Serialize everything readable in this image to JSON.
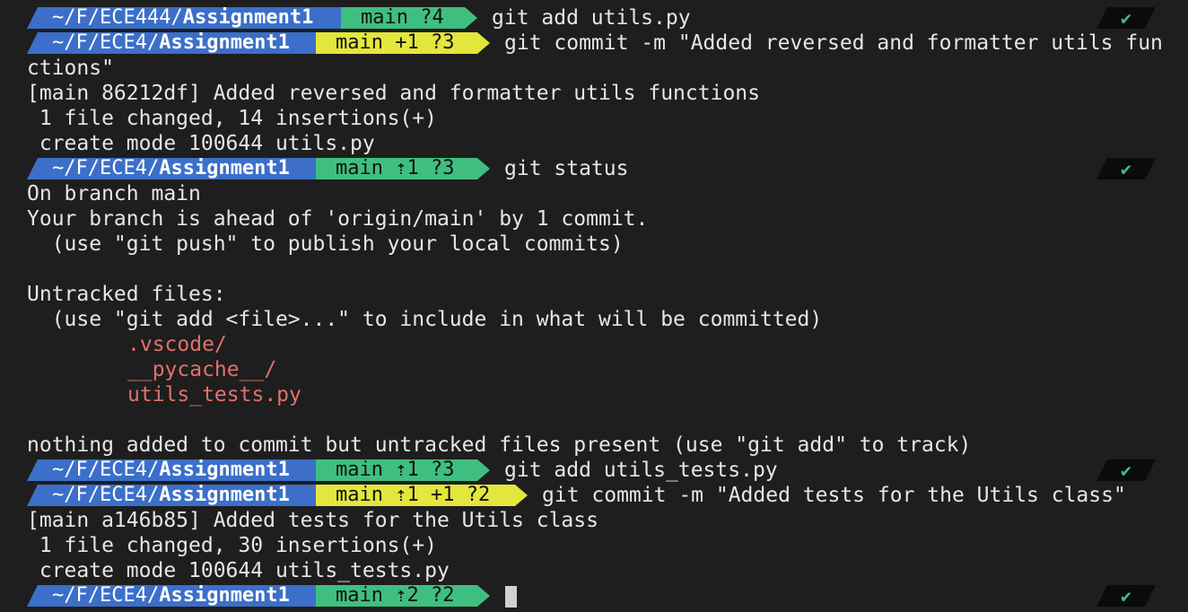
{
  "colors": {
    "background": "#1e1e1e",
    "dir_segment": "#3b6fc9",
    "git_clean": "#3fbf7f",
    "git_dirty": "#e3e63c",
    "untracked": "#e0716c",
    "status_ok": "#3fbf7f"
  },
  "status_icon": "✔",
  "prompts": [
    {
      "dir_prefix": "~/F/ECE444/",
      "dir_bold": "Assignment1",
      "git": "main ?4",
      "git_state": "clean",
      "command": "git add utils.py"
    },
    {
      "dir_prefix": "~/F/ECE4/",
      "dir_bold": "Assignment1",
      "git": "main +1 ?3",
      "git_state": "dirty",
      "command": "git commit -m \"Added reversed and formatter utils fun"
    },
    {
      "dir_prefix": "~/F/ECE4/",
      "dir_bold": "Assignment1",
      "git": "main ⇡1 ?3",
      "git_state": "clean",
      "command": "git status"
    },
    {
      "dir_prefix": "~/F/ECE4/",
      "dir_bold": "Assignment1",
      "git": "main ⇡1 ?3",
      "git_state": "clean",
      "command": "git add utils_tests.py"
    },
    {
      "dir_prefix": "~/F/ECE4/",
      "dir_bold": "Assignment1",
      "git": "main ⇡1 +1 ?2",
      "git_state": "dirty",
      "command": "git commit -m \"Added tests for the Utils class\""
    },
    {
      "dir_prefix": "~/F/ECE4/",
      "dir_bold": "Assignment1",
      "git": "main ⇡2 ?2",
      "git_state": "clean",
      "command": ""
    }
  ],
  "output": {
    "commit1_wrap": "ctions\"",
    "commit1_result": "[main 86212df] Added reversed and formatter utils functions",
    "commit1_changed": " 1 file changed, 14 insertions(+)",
    "commit1_create": " create mode 100644 utils.py",
    "status_branch": "On branch main",
    "status_ahead": "Your branch is ahead of 'origin/main' by 1 commit.",
    "status_hint_push": "  (use \"git push\" to publish your local commits)",
    "untracked_header": "Untracked files:",
    "untracked_hint": "  (use \"git add <file>...\" to include in what will be committed)",
    "untracked_files": [
      ".vscode/",
      "__pycache__/",
      "utils_tests.py"
    ],
    "nothing_added": "nothing added to commit but untracked files present (use \"git add\" to track)",
    "commit2_result": "[main a146b85] Added tests for the Utils class",
    "commit2_changed": " 1 file changed, 30 insertions(+)",
    "commit2_create": " create mode 100644 utils_tests.py"
  }
}
